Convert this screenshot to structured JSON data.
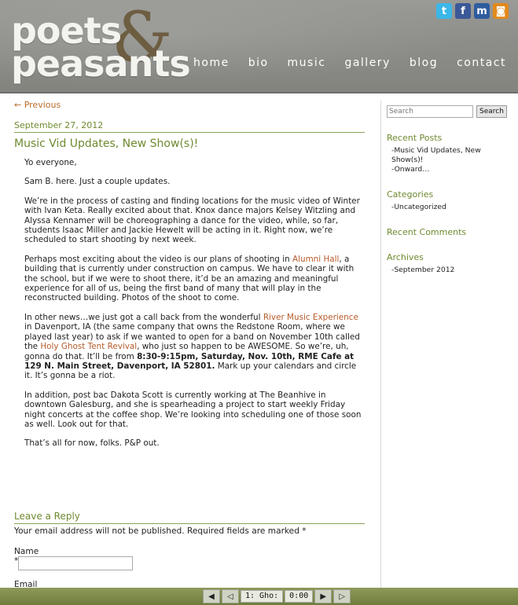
{
  "header": {
    "logo_line1": "poets",
    "logo_line2": "peasants",
    "logo_amp": "&",
    "nav": [
      "home",
      "bio",
      "music",
      "gallery",
      "blog",
      "contact"
    ],
    "social": [
      {
        "name": "twitter",
        "glyph": "t",
        "color": "#3bb7e8"
      },
      {
        "name": "facebook",
        "glyph": "f",
        "color": "#3b5998"
      },
      {
        "name": "myspace",
        "glyph": "m",
        "color": "#2f5c9e"
      },
      {
        "name": "rss",
        "glyph": "◙",
        "color": "#e2891a"
      }
    ]
  },
  "post": {
    "previous_label": "← Previous",
    "date": "September 27, 2012",
    "title": "Music Vid Updates, New Show(s)!",
    "p1": "Yo everyone,",
    "p2": "Sam B. here. Just a couple updates.",
    "p3": "We’re in the process of casting and finding locations for the music video of Winter with Ivan Keta.  Really excited about that.  Knox dance majors Kelsey Witzling and Alyssa Kennamer will be choreographing a dance for the video, while, so far, students Isaac Miller and Jackie Hewelt will be acting in it.  Right now, we’re scheduled to start shooting by next week.",
    "p4_a": "Perhaps most exciting about the video is our plans of shooting in ",
    "p4_link": "Alumni Hall",
    "p4_b": ", a building that is currently under construction on campus.  We have to clear it with the school, but if we were to shoot there, it’d be an amazing and meaningful experience for all of us, being the first band of many that will play in the reconstructed building.  Photos of the shoot to come.",
    "p5_a": "In other news…we just got a call back from the wonderful ",
    "p5_link1": "River Music Experience",
    "p5_b": " in Davenport, IA (the same company that owns the Redstone Room, where we played last year) to ask if we wanted to open for a band on November 10th called the ",
    "p5_link2": "Holy Ghost Tent Revival",
    "p5_c": ", who just so happen to be AWESOME.  So we’re, uh, gonna do that.  It’ll be from ",
    "p5_bold": "8:30-9:15pm, Saturday, Nov. 10th, RME Cafe at 129 N. Main Street, Davenport, IA 52801.",
    "p5_d": "  Mark up your calendars and circle it. It’s gonna be a riot.",
    "p6": "In addition, post bac Dakota Scott is currently working at The Beanhive in downtown Galesburg, and she is spearheading a project to start weekly Friday night concerts at the coffee shop.  We’re looking into scheduling one of those soon as well.  Look out for that.",
    "p7": "That’s all for now, folks. P&P out."
  },
  "reply": {
    "title": "Leave a Reply",
    "note": "Your email address will not be published. Required fields are marked *",
    "name_label": "Name",
    "required_mark": "*",
    "email_label": "Email",
    "name_value": ""
  },
  "sidebar": {
    "search_placeholder": "Search",
    "search_button": "Search",
    "recent_posts_title": "Recent Posts",
    "recent_posts": [
      "-Music Vid Updates, New Show(s)!",
      "-Onward…"
    ],
    "categories_title": "Categories",
    "categories": [
      "-Uncategorized"
    ],
    "recent_comments_title": "Recent Comments",
    "archives_title": "Archives",
    "archives": [
      "-September 2012"
    ]
  },
  "player": {
    "track_label": "1: Gho:",
    "time": "0:00"
  }
}
